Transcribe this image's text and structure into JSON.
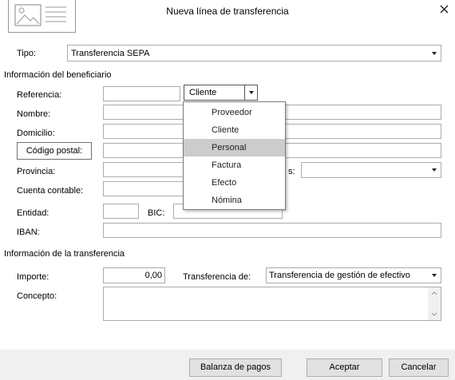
{
  "dialog": {
    "title": "Nueva línea de transferencia"
  },
  "tipo": {
    "label": "Tipo:",
    "value": "Transferencia SEPA"
  },
  "beneficiario": {
    "section_title": "Información del beneficiario",
    "referencia_label": "Referencia:",
    "referencia_value": "",
    "tipo_select": "Cliente",
    "nombre_label": "Nombre:",
    "domicilio_label": "Domicilio:",
    "codigo_postal_button": "Código postal:",
    "provincia_label": "Provincia:",
    "pais_label_fragment": "s:",
    "cuenta_label": "Cuenta contable:",
    "entidad_label": "Entidad:",
    "bic_label": "BIC:",
    "iban_label": "IBAN:"
  },
  "dropdown": {
    "options": [
      "Proveedor",
      "Cliente",
      "Personal",
      "Factura",
      "Efecto",
      "Nómina"
    ],
    "highlighted": "Personal"
  },
  "transferencia": {
    "section_title": "Información de la transferencia",
    "importe_label": "Importe:",
    "importe_value": "0,00",
    "transferencia_de_label": "Transferencia de:",
    "transferencia_de_value": "Transferencia de gestión de efectivo",
    "concepto_label": "Concepto:"
  },
  "footer": {
    "balanza_button": "Balanza de pagos",
    "aceptar_button": "Aceptar",
    "cancelar_button": "Cancelar"
  }
}
